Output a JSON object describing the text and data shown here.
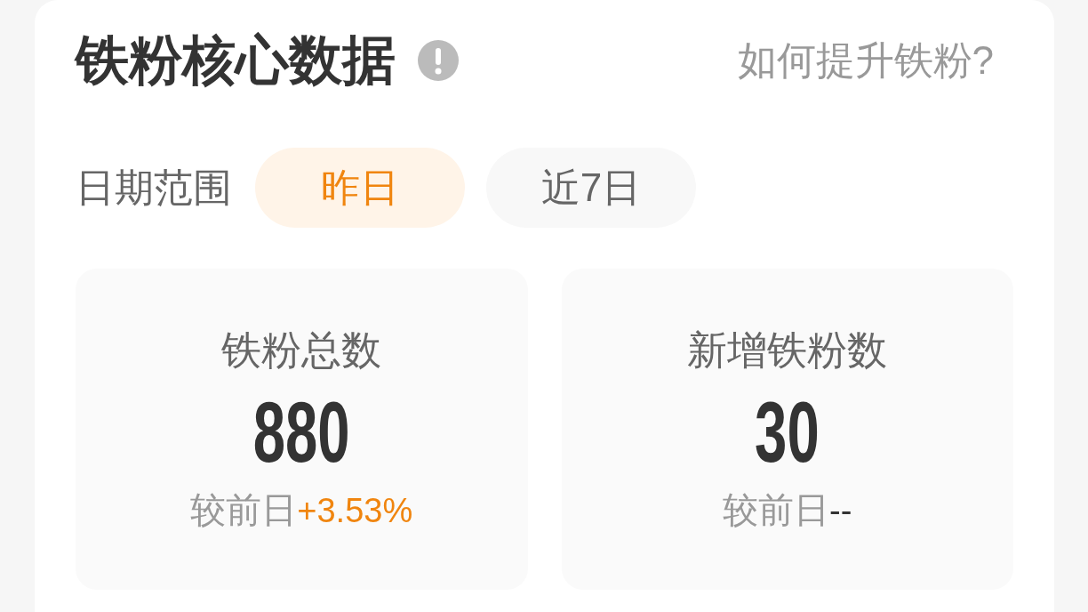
{
  "header": {
    "title": "铁粉核心数据",
    "help_link": "如何提升铁粉?"
  },
  "date_range": {
    "label": "日期范围",
    "options": [
      {
        "label": "昨日",
        "selected": true
      },
      {
        "label": "近7日",
        "selected": false
      }
    ]
  },
  "metrics": [
    {
      "label": "铁粉总数",
      "value": "880",
      "compare_label": "较前日",
      "change": "+3.53%",
      "color": "#f0850f"
    },
    {
      "label": "新增铁粉数",
      "value": "30",
      "compare_label": "较前日",
      "change": "--",
      "color": "#333333"
    }
  ]
}
